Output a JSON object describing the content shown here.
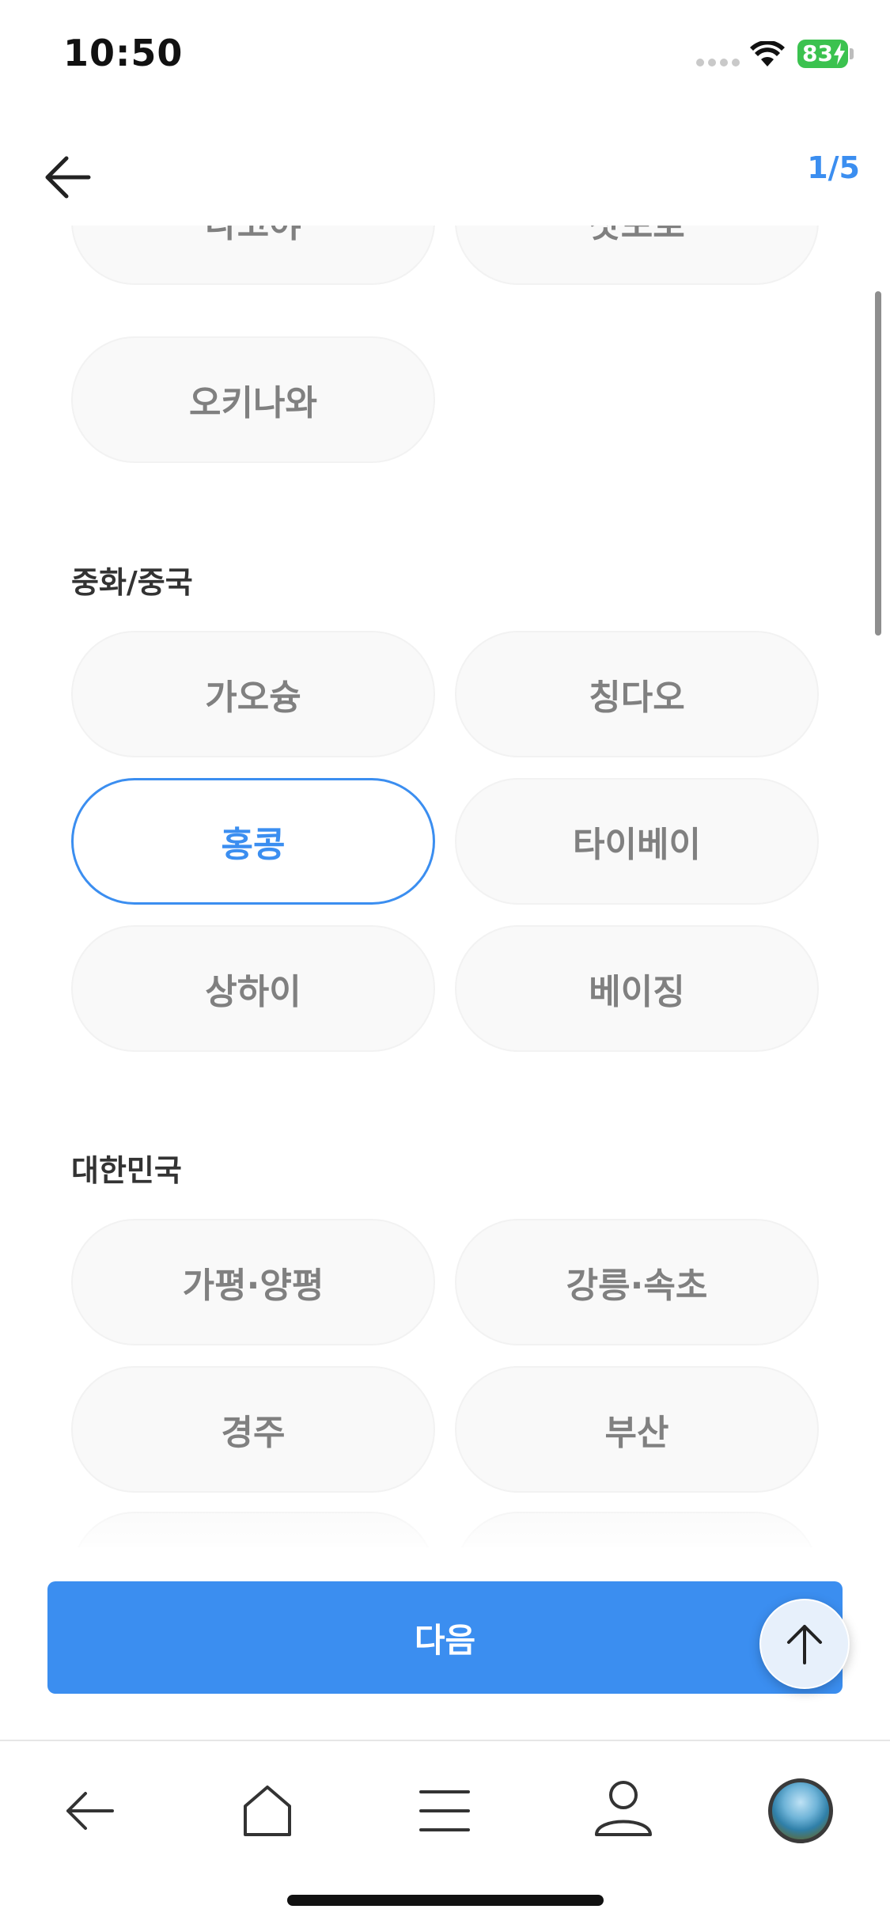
{
  "status_bar": {
    "time": "10:50",
    "battery": "83"
  },
  "header": {
    "step": "1/5"
  },
  "sections": {
    "japan_partial": {
      "items": [
        "나고야",
        "삿포로",
        "오키나와"
      ]
    },
    "china": {
      "title": "중화/중국",
      "items": [
        "가오슝",
        "칭다오",
        "홍콩",
        "타이베이",
        "상하이",
        "베이징"
      ],
      "selected": "홍콩"
    },
    "korea": {
      "title": "대한민국",
      "items": [
        "가평·양평",
        "강릉·속초",
        "경주",
        "부산"
      ]
    }
  },
  "actions": {
    "next_label": "다음"
  },
  "colors": {
    "accent": "#3b8ef0",
    "chip_bg": "#f9f9f9",
    "chip_text": "#808080"
  },
  "icons": {
    "back": "arrow-left-icon",
    "scroll_top": "arrow-up-icon",
    "nav_back": "arrow-left-icon",
    "nav_home": "home-icon",
    "nav_menu": "menu-icon",
    "nav_profile": "user-icon"
  }
}
